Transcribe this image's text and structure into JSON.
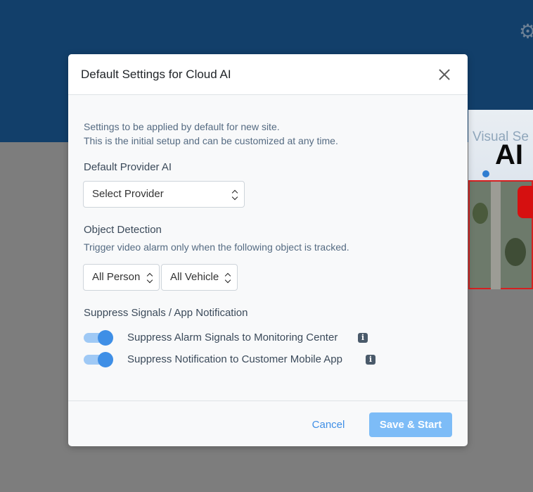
{
  "background": {
    "banner_text_1": "Visual Se",
    "banner_text_2": "AI"
  },
  "modal": {
    "title": "Default Settings for Cloud AI",
    "intro_line_1": "Settings to be applied by default for new site.",
    "intro_line_2": "This is the initial setup and can be customized at any time.",
    "provider": {
      "label": "Default Provider AI",
      "selected": "Select Provider"
    },
    "object_detection": {
      "label": "Object Detection",
      "description": "Trigger video alarm only when the following object is tracked.",
      "person_selected": "All Person",
      "vehicle_selected": "All Vehicle"
    },
    "suppress": {
      "label": "Suppress Signals / App Notification",
      "items": [
        {
          "label": "Suppress Alarm Signals to Monitoring Center",
          "on": true
        },
        {
          "label": "Suppress Notification to Customer Mobile App",
          "on": true
        }
      ]
    },
    "footer": {
      "cancel_label": "Cancel",
      "save_label": "Save & Start"
    }
  },
  "colors": {
    "header_bg": "#123f6a",
    "overlay_bg": "#7d7d7d",
    "toggle_track": "#9fc9f5",
    "toggle_knob": "#3f8fe6",
    "primary_link": "#3f8fe6",
    "save_button": "#7dbcf7"
  },
  "icons": {
    "close": "close-icon",
    "info": "info-icon",
    "gear": "gear-icon",
    "select_caret": "chevron-up-down-icon"
  }
}
